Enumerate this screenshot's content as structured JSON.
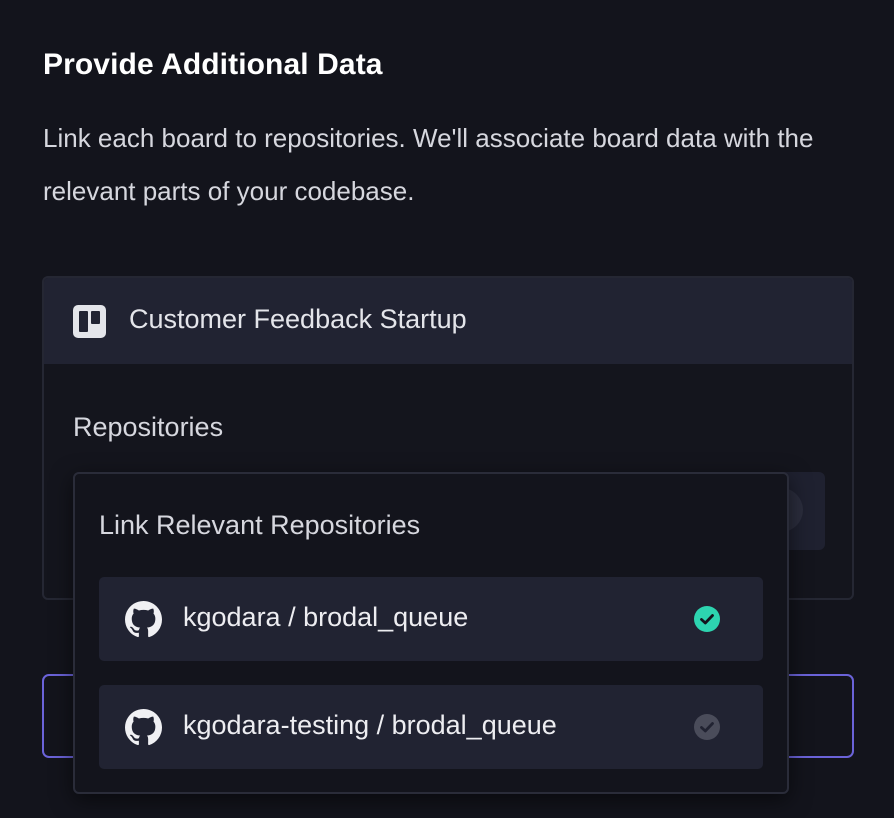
{
  "page": {
    "title": "Provide Additional Data",
    "description": "Link each board to repositories. We'll associate board data with the relevant parts of your codebase."
  },
  "board": {
    "icon": "trello-board-icon",
    "name": "Customer Feedback Startup",
    "repositories_label": "Repositories"
  },
  "dropdown": {
    "title": "Link Relevant Repositories",
    "items": [
      {
        "name": "kgodara / brodal_queue",
        "icon": "github-icon",
        "selected": true,
        "check_color": "#2dd4b0"
      },
      {
        "name": "kgodara-testing / brodal_queue",
        "icon": "github-icon",
        "selected": false,
        "check_color": "#4a4c5a"
      }
    ]
  },
  "colors": {
    "background": "#13141c",
    "card_header": "#212332",
    "accent_border": "#6b63d9",
    "selected_check": "#2dd4b0",
    "unselected_check": "#4a4c5a"
  }
}
